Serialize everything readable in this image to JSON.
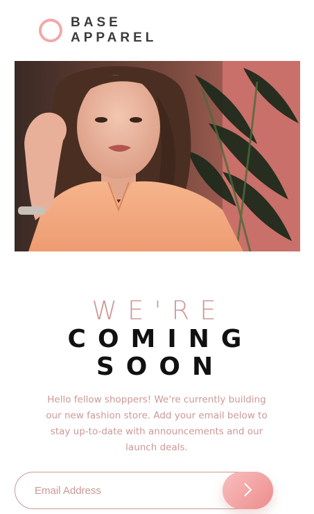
{
  "header": {
    "logo_line1": "BASE",
    "logo_line2": "APPAREL"
  },
  "hero": {
    "image": "woman-in-peach-shirt-photo"
  },
  "headline": {
    "light": "WE'RE",
    "bold_line1": "COMING",
    "bold_line2": "SOON"
  },
  "description": "Hello fellow shoppers! We're currently building our new fashion store. Add your email below to stay up-to-date with announcements and our launch deals.",
  "form": {
    "email_placeholder": "Email Address",
    "email_value": "",
    "submit_icon": "arrow-right-icon"
  },
  "colors": {
    "accent": "#ce9797",
    "gradient_start": "#f8bfbf",
    "gradient_end": "#ee8c8c",
    "dark_text": "#3b3b3b"
  }
}
